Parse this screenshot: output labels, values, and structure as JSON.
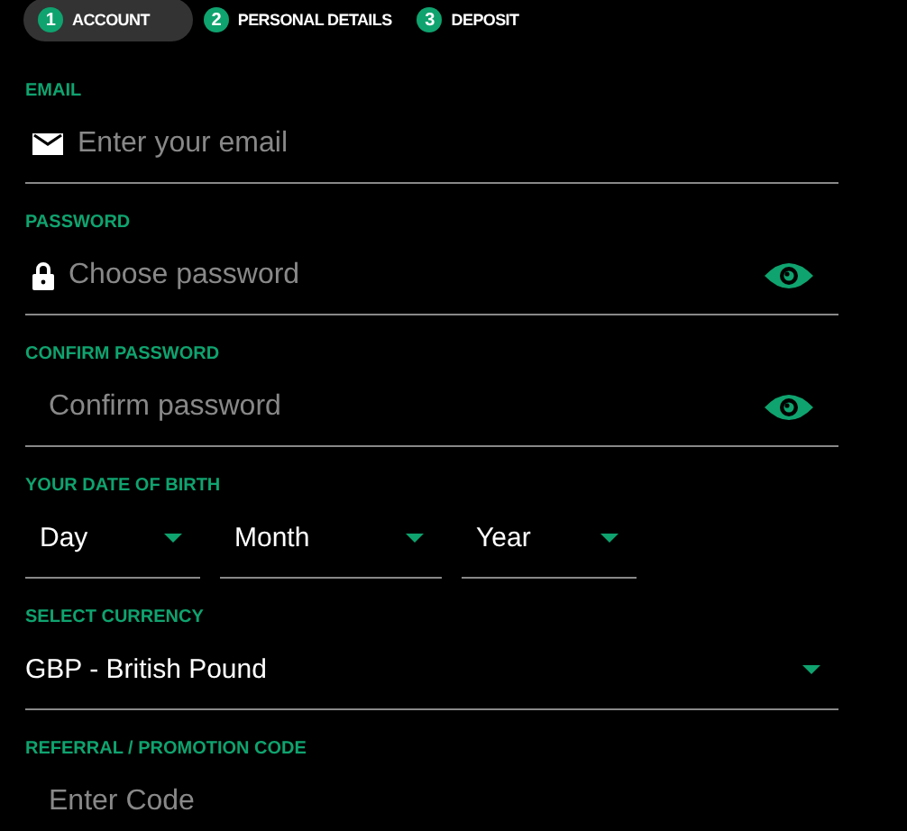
{
  "steps": [
    {
      "number": "1",
      "label": "ACCOUNT",
      "selected": true
    },
    {
      "number": "2",
      "label": "PERSONAL DETAILS",
      "selected": false
    },
    {
      "number": "3",
      "label": "DEPOSIT",
      "selected": false
    }
  ],
  "email": {
    "label": "EMAIL",
    "placeholder": "Enter your email"
  },
  "password": {
    "label": "PASSWORD",
    "placeholder": "Choose password"
  },
  "confirm_password": {
    "label": "CONFIRM PASSWORD",
    "placeholder": "Confirm password"
  },
  "date_of_birth": {
    "label": "YOUR DATE OF BIRTH",
    "selects": [
      {
        "value": "Day"
      },
      {
        "value": "Month"
      },
      {
        "value": "Year"
      }
    ]
  },
  "currency": {
    "label": "SELECT CURRENCY",
    "value": "GBP - British Pound"
  },
  "referral_code": {
    "label": "REFERRAL / PROMOTION CODE",
    "placeholder": "Enter Code"
  }
}
